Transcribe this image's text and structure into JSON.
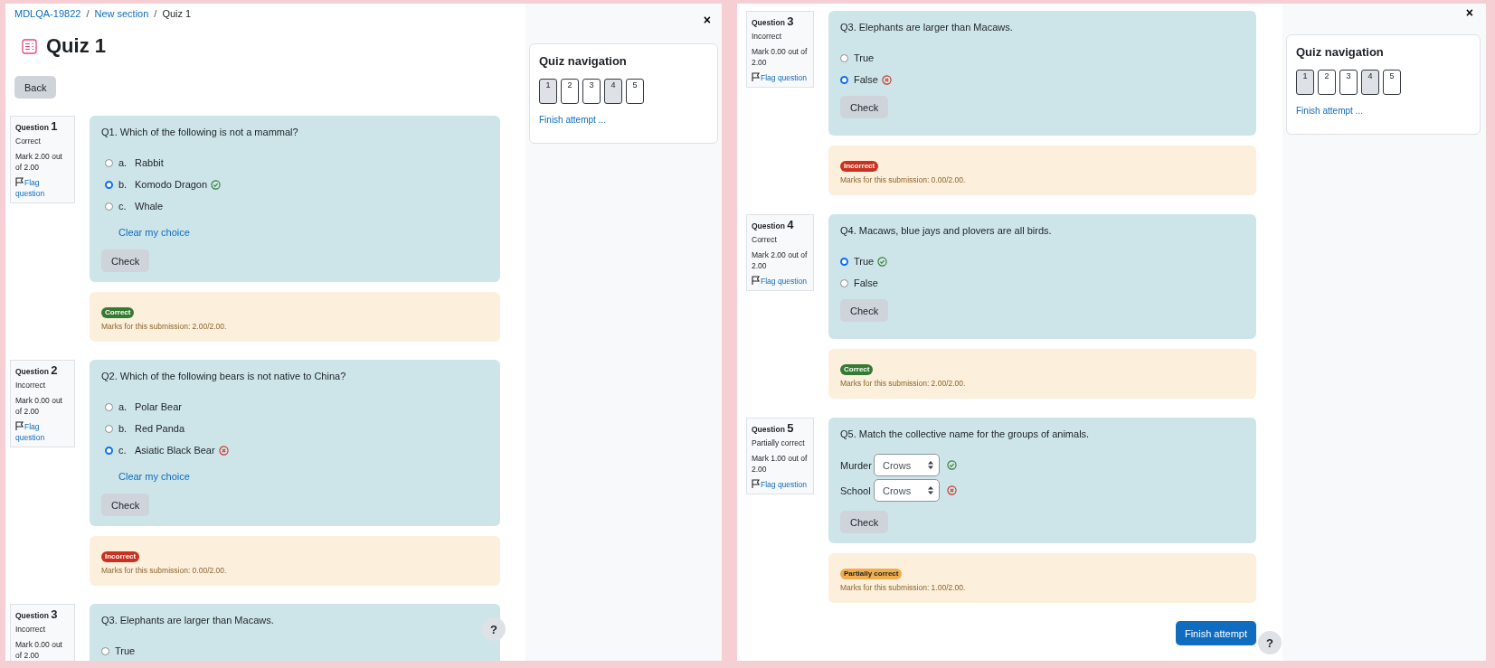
{
  "panels": [
    {
      "breadcrumb": [
        {
          "text": "MDLQA-19822",
          "link": true
        },
        {
          "separator": "/"
        },
        {
          "text": "New section",
          "link": true
        },
        {
          "separator": "/"
        },
        {
          "text": "Quiz 1",
          "link": false
        }
      ],
      "title": "Quiz 1",
      "back_button": "Back",
      "questions": [
        {
          "kind": "multichoice",
          "label": "Question",
          "number": "1",
          "state": "Correct",
          "mark": "Mark 2.00 out of 2.00",
          "flag": "Flag question",
          "text": "Q1. Which of the following is not a mammal?",
          "options": [
            {
              "letter": "a.",
              "text": "Rabbit",
              "selected": false,
              "graded": false
            },
            {
              "letter": "b.",
              "text": "Komodo Dragon",
              "selected": true,
              "graded": true,
              "correct": true
            },
            {
              "letter": "c.",
              "text": "Whale",
              "selected": false,
              "graded": false
            }
          ],
          "clear": "Clear my choice",
          "check": "Check",
          "feedback": {
            "kind": "correct",
            "badge": "Correct",
            "marks": "Marks for this submission: 2.00/2.00."
          }
        },
        {
          "kind": "multichoice",
          "label": "Question",
          "number": "2",
          "state": "Incorrect",
          "mark": "Mark 0.00 out of 2.00",
          "flag": "Flag question",
          "text": "Q2. Which of the following bears is not native to China?",
          "options": [
            {
              "letter": "a.",
              "text": "Polar Bear",
              "selected": false,
              "graded": false
            },
            {
              "letter": "b.",
              "text": "Red Panda",
              "selected": false,
              "graded": false
            },
            {
              "letter": "c.",
              "text": "Asiatic Black Bear",
              "selected": true,
              "graded": true,
              "correct": false
            }
          ],
          "clear": "Clear my choice",
          "check": "Check",
          "feedback": {
            "kind": "incorrect",
            "badge": "Incorrect",
            "marks": "Marks for this submission: 0.00/2.00."
          }
        },
        {
          "kind": "truefalse",
          "label": "Question",
          "number": "3",
          "state": "Incorrect",
          "mark": "Mark 0.00 out of 2.00",
          "text": "Q3. Elephants are larger than Macaws.",
          "options": [
            {
              "text": "True",
              "selected": false,
              "graded": false
            }
          ]
        }
      ],
      "help_button": "?",
      "drawer": {
        "close": "×",
        "title": "Quiz navigation",
        "buttons": [
          {
            "label": "1",
            "correct": true
          },
          {
            "label": "2",
            "correct": false
          },
          {
            "label": "3",
            "correct": false
          },
          {
            "label": "4",
            "correct": true
          },
          {
            "label": "5",
            "correct": false
          }
        ],
        "finish_link": "Finish attempt ..."
      }
    },
    {
      "questions": [
        {
          "kind": "truefalse",
          "label": "Question",
          "number": "3",
          "state": "Incorrect",
          "mark": "Mark 0.00 out of 2.00",
          "flag": "Flag question",
          "text": "Q3. Elephants are larger than Macaws.",
          "options": [
            {
              "text": "True",
              "selected": false,
              "graded": false
            },
            {
              "text": "False",
              "selected": true,
              "graded": true,
              "correct": false
            }
          ],
          "check": "Check",
          "feedback": {
            "kind": "incorrect",
            "badge": "Incorrect",
            "marks": "Marks for this submission: 0.00/2.00."
          }
        },
        {
          "kind": "truefalse",
          "label": "Question",
          "number": "4",
          "state": "Correct",
          "mark": "Mark 2.00 out of 2.00",
          "flag": "Flag question",
          "text": "Q4. Macaws, blue jays and plovers are all birds.",
          "options": [
            {
              "text": "True",
              "selected": true,
              "graded": true,
              "correct": true
            },
            {
              "text": "False",
              "selected": false,
              "graded": false
            }
          ],
          "check": "Check",
          "feedback": {
            "kind": "correct",
            "badge": "Correct",
            "marks": "Marks for this submission: 2.00/2.00."
          }
        },
        {
          "kind": "match",
          "label": "Question",
          "number": "5",
          "state": "Partially correct",
          "mark": "Mark 1.00 out of 2.00",
          "flag": "Flag question",
          "text": "Q5. Match the collective name for the groups of animals.",
          "matches": [
            {
              "term": "Murder",
              "value": "Crows",
              "correct": true
            },
            {
              "term": "School",
              "value": "Crows",
              "correct": false
            }
          ],
          "check": "Check",
          "feedback": {
            "kind": "partial",
            "badge": "Partially correct",
            "marks": "Marks for this submission: 1.00/2.00."
          }
        }
      ],
      "finish_button": "Finish attempt",
      "help_button": "?",
      "drawer": {
        "close": "×",
        "title": "Quiz navigation",
        "buttons": [
          {
            "label": "1",
            "correct": true
          },
          {
            "label": "2",
            "correct": false
          },
          {
            "label": "3",
            "correct": false
          },
          {
            "label": "4",
            "correct": true
          },
          {
            "label": "5",
            "correct": false
          }
        ],
        "finish_link": "Finish attempt ..."
      }
    }
  ]
}
